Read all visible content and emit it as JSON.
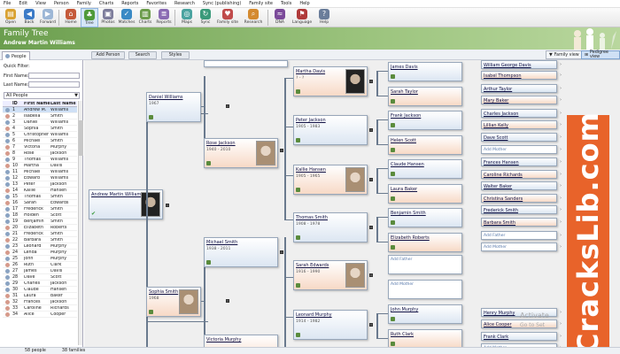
{
  "menu": [
    "File",
    "Edit",
    "View",
    "Person",
    "Family",
    "Charts",
    "Reports",
    "Favorites",
    "Research",
    "Sync (publishing)",
    "Family site",
    "Tools",
    "Help"
  ],
  "toolbar": [
    {
      "label": "Open",
      "icon": "folder-icon",
      "color": "#d9a232"
    },
    {
      "label": "Back",
      "icon": "back-arrow-icon",
      "color": "#3c7bc7"
    },
    {
      "label": "Forward",
      "icon": "forward-arrow-icon",
      "color": "#9db7d6"
    },
    {
      "label": "Home",
      "icon": "home-icon",
      "color": "#c55a3a"
    },
    {
      "label": "Tree",
      "icon": "tree-icon",
      "color": "#4f9a3a"
    },
    {
      "label": "Photos",
      "icon": "photos-icon",
      "color": "#7d7d9c"
    },
    {
      "label": "Matches",
      "icon": "matches-icon",
      "color": "#3a8ac5"
    },
    {
      "label": "Charts",
      "icon": "charts-icon",
      "color": "#6c9c4c"
    },
    {
      "label": "Reports",
      "icon": "reports-icon",
      "color": "#8a6bb3"
    },
    {
      "label": "Maps",
      "icon": "maps-icon",
      "color": "#4aa3a0"
    },
    {
      "label": "Sync",
      "icon": "sync-icon",
      "color": "#3a9a7a"
    },
    {
      "label": "Family site",
      "icon": "family-site-icon",
      "color": "#c04b4b"
    },
    {
      "label": "Research",
      "icon": "research-icon",
      "color": "#d48a2f"
    },
    {
      "label": "DNA",
      "icon": "dna-icon",
      "color": "#7b4a9a"
    },
    {
      "label": "Language",
      "icon": "flag-icon",
      "color": "#b03a3a"
    },
    {
      "label": "Help",
      "icon": "help-icon",
      "color": "#6a7d9a"
    }
  ],
  "banner": {
    "title": "Family Tree",
    "person": "Andrew Martin Williams"
  },
  "people_tab": "People",
  "quick_filter": {
    "title": "Quick Filter:",
    "first": "First Name:",
    "last": "Last Name:"
  },
  "filter_select": "All People",
  "grid_headers": [
    "ID",
    "First Name",
    "Last Name"
  ],
  "people": [
    {
      "id": "1",
      "first": "Andrew M.",
      "last": "Williams",
      "g": "m"
    },
    {
      "id": "2",
      "first": "Isabella",
      "last": "Smith",
      "g": "f"
    },
    {
      "id": "3",
      "first": "Daniel",
      "last": "Williams",
      "g": "m"
    },
    {
      "id": "4",
      "first": "Sophia",
      "last": "Smith",
      "g": "f"
    },
    {
      "id": "5",
      "first": "Christopher",
      "last": "Williams",
      "g": "m"
    },
    {
      "id": "6",
      "first": "Michael",
      "last": "Smith",
      "g": "m"
    },
    {
      "id": "7",
      "first": "Victoria",
      "last": "Murphy",
      "g": "f"
    },
    {
      "id": "8",
      "first": "Rose",
      "last": "Jackson",
      "g": "f"
    },
    {
      "id": "9",
      "first": "Thomas",
      "last": "Williams",
      "g": "m"
    },
    {
      "id": "10",
      "first": "Martha",
      "last": "Davis",
      "g": "f"
    },
    {
      "id": "11",
      "first": "Michael",
      "last": "Williams",
      "g": "m"
    },
    {
      "id": "12",
      "first": "Edward",
      "last": "Williams",
      "g": "m"
    },
    {
      "id": "13",
      "first": "Peter",
      "last": "Jackson",
      "g": "m"
    },
    {
      "id": "14",
      "first": "Kallie",
      "last": "Hansen",
      "g": "f"
    },
    {
      "id": "15",
      "first": "Thomas",
      "last": "Smith",
      "g": "m"
    },
    {
      "id": "16",
      "first": "Sarah",
      "last": "Edwards",
      "g": "f"
    },
    {
      "id": "17",
      "first": "Frederick",
      "last": "Smith",
      "g": "m"
    },
    {
      "id": "18",
      "first": "Holden",
      "last": "Scott",
      "g": "m"
    },
    {
      "id": "19",
      "first": "Benjamin",
      "last": "Smith",
      "g": "m"
    },
    {
      "id": "20",
      "first": "Elizabeth",
      "last": "Roberts",
      "g": "f"
    },
    {
      "id": "21",
      "first": "Frederick",
      "last": "Smith",
      "g": "m"
    },
    {
      "id": "22",
      "first": "Barbara",
      "last": "Smith",
      "g": "f"
    },
    {
      "id": "23",
      "first": "Leonard",
      "last": "Murphy",
      "g": "m"
    },
    {
      "id": "24",
      "first": "Lenda",
      "last": "Murphy",
      "g": "f"
    },
    {
      "id": "25",
      "first": "John",
      "last": "Murphy",
      "g": "m"
    },
    {
      "id": "26",
      "first": "Ruth",
      "last": "Clark",
      "g": "f"
    },
    {
      "id": "27",
      "first": "James",
      "last": "Davis",
      "g": "m"
    },
    {
      "id": "28",
      "first": "Dave",
      "last": "Scott",
      "g": "m"
    },
    {
      "id": "29",
      "first": "Charles",
      "last": "Jackson",
      "g": "m"
    },
    {
      "id": "30",
      "first": "Claude",
      "last": "Hansen",
      "g": "m"
    },
    {
      "id": "31",
      "first": "Laura",
      "last": "Baker",
      "g": "f"
    },
    {
      "id": "32",
      "first": "Frances",
      "last": "Jackson",
      "g": "f"
    },
    {
      "id": "33",
      "first": "Caroline",
      "last": "Richards",
      "g": "f"
    },
    {
      "id": "34",
      "first": "Alice",
      "last": "Cooper",
      "g": "f"
    }
  ],
  "canvas_toolbar": {
    "add": "Add Person",
    "search": "Search",
    "styles": "Styles",
    "family_view": "Family view",
    "pedigree_view": "Pedigree view"
  },
  "cards": {
    "root": {
      "name": "Andrew Martin Williams"
    },
    "g1": [
      {
        "name": "Daniel Williams",
        "dates": "1967",
        "g": "m"
      },
      {
        "name": "Sophia Smith",
        "dates": "1968",
        "g": "f"
      }
    ],
    "g2": [
      {
        "name": "Rose Jackson",
        "dates": "1940 - 2010",
        "g": "f"
      },
      {
        "name": "Michael Smith",
        "dates": "1938 - 2011",
        "g": "m"
      },
      {
        "name": "Victoria Murphy",
        "dates": "",
        "g": "f"
      }
    ],
    "g3": [
      {
        "name": "Martha Davis",
        "dates": "? - ?",
        "g": "f"
      },
      {
        "name": "Peter Jackson",
        "dates": "1905 - 1983",
        "g": "m"
      },
      {
        "name": "Kallie Hansen",
        "dates": "1905 - 1965",
        "g": "f"
      },
      {
        "name": "Thomas Smith",
        "dates": "1908 - 1978",
        "g": "m"
      },
      {
        "name": "Sarah Edwards",
        "dates": "1916 - 1990",
        "g": "f"
      },
      {
        "name": "Leonard Murphy",
        "dates": "1914 - 1982",
        "g": "m"
      }
    ],
    "g4": [
      {
        "name": "James Davis",
        "dates": "",
        "g": "m"
      },
      {
        "name": "Sarah Taylor",
        "dates": "",
        "g": "f"
      },
      {
        "name": "Frank Jackson",
        "dates": "",
        "g": "m"
      },
      {
        "name": "Helen Scott",
        "dates": "",
        "g": "f"
      },
      {
        "name": "Claude Hansen",
        "dates": "",
        "g": "m"
      },
      {
        "name": "Laura Baker",
        "dates": "",
        "g": "f"
      },
      {
        "name": "Benjamin Smith",
        "dates": "",
        "g": "m"
      },
      {
        "name": "Elizabeth Roberts",
        "dates": "",
        "g": "f"
      },
      {
        "name": "John Murphy",
        "dates": "",
        "g": "m"
      },
      {
        "name": "Ruth Clark",
        "dates": "",
        "g": "f"
      }
    ],
    "g5": [
      "William George Davis",
      "Isabel Thompson",
      "Arthur Taylor",
      "Mary Baker",
      "Charles Jackson",
      "Lillian Kelly",
      "Dave Scott",
      "Add Mother",
      "Frances Hansen",
      "Caroline Richards",
      "Walter Baker",
      "Christina Sanders",
      "Frederick Smith",
      "Barbara Smith",
      "Add Father",
      "Add Mother",
      "Henry Murphy",
      "Alice Cooper",
      "Frank Clark",
      "Add Mother"
    ]
  },
  "add_father": "Add Father",
  "add_mother": "Add Mother",
  "watermark": "CracksLib.com",
  "activate": {
    "line1": "Activate",
    "line2": "Go to Set"
  },
  "status": {
    "people": "58 people",
    "families": "38 families"
  }
}
